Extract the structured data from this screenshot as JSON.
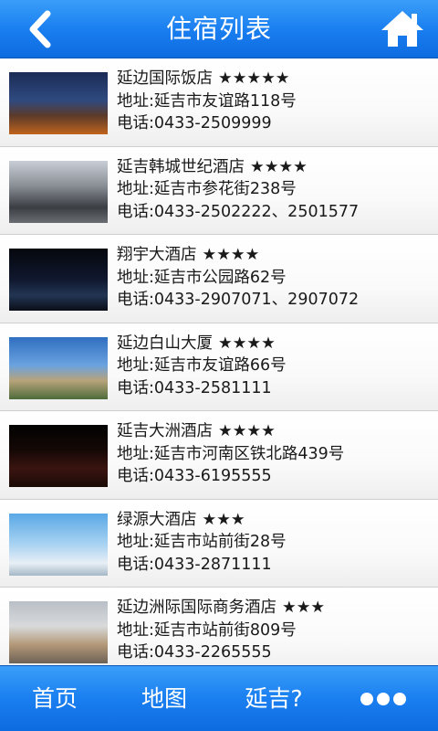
{
  "header": {
    "title": "住宿列表",
    "back_icon": "chevron-left-icon",
    "home_icon": "home-icon"
  },
  "hotels": [
    {
      "name": "延边国际饭店",
      "stars": "★★★★★",
      "address": "地址:延吉市友谊路118号",
      "phone": "电话:0433-2509999"
    },
    {
      "name": "延吉韩城世纪酒店",
      "stars": "★★★★",
      "address": "地址:延吉市参花街238号",
      "phone": "电话:0433-2502222、2501577"
    },
    {
      "name": "翔宇大酒店",
      "stars": "★★★★",
      "address": "地址:延吉市公园路62号",
      "phone": "电话:0433-2907071、2907072"
    },
    {
      "name": "延边白山大厦",
      "stars": "★★★★",
      "address": "地址:延吉市友谊路66号",
      "phone": "电话:0433-2581111"
    },
    {
      "name": "延吉大洲酒店",
      "stars": "★★★★",
      "address": "地址:延吉市河南区铁北路439号",
      "phone": "电话:0433-6195555"
    },
    {
      "name": "绿源大酒店",
      "stars": "★★★",
      "address": "地址:延吉市站前街28号",
      "phone": "电话:0433-2871111"
    },
    {
      "name": "延边洲际国际商务酒店",
      "stars": "★★★",
      "address": "地址:延吉市站前街809号",
      "phone": "电话:0433-2265555"
    }
  ],
  "tabbar": {
    "home": "首页",
    "map": "地图",
    "yanji": "延吉?",
    "more_icon": "more-dots-icon"
  },
  "colors": {
    "bar_blue": "#1a7ff0",
    "text": "#1a1a1a"
  }
}
